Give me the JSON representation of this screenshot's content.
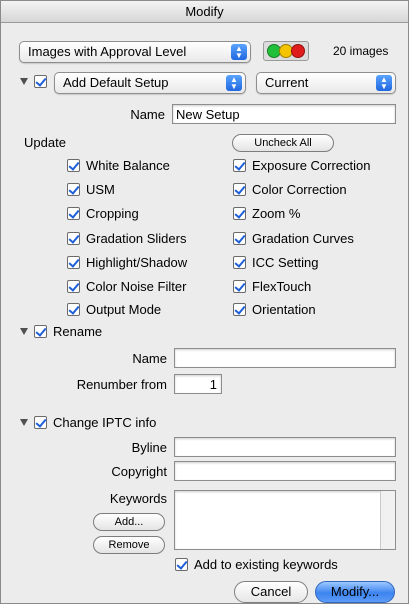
{
  "window": {
    "title": "Modify"
  },
  "filter": {
    "selected": "Images with Approval Level",
    "count": "20 images"
  },
  "colors": {
    "approval_green": "#22c03a",
    "approval_yellow": "#f4c400",
    "approval_red": "#e01b1b",
    "accent": "#2f7af0"
  },
  "setup": {
    "enabled": true,
    "preset": "Add Default Setup",
    "scope": "Current",
    "name_label": "Name",
    "name_value": "New Setup"
  },
  "update": {
    "label": "Update",
    "uncheck_all": "Uncheck All",
    "items_left": [
      "White Balance",
      "USM",
      "Cropping",
      "Gradation Sliders",
      "Highlight/Shadow",
      "Color Noise Filter",
      "Output Mode"
    ],
    "items_right": [
      "Exposure Correction",
      "Color Correction",
      "Zoom %",
      "Gradation Curves",
      "ICC Setting",
      "FlexTouch",
      "Orientation"
    ]
  },
  "rename": {
    "label": "Rename",
    "name_label": "Name",
    "name_value": "",
    "renumber_label": "Renumber from",
    "renumber_value": "1"
  },
  "iptc": {
    "label": "Change IPTC info",
    "byline_label": "Byline",
    "byline_value": "",
    "copyright_label": "Copyright",
    "copyright_value": "",
    "keywords_label": "Keywords",
    "keywords_value": "",
    "add_button": "Add...",
    "remove_button": "Remove",
    "add_existing_label": "Add to existing keywords"
  },
  "buttons": {
    "cancel": "Cancel",
    "modify": "Modify..."
  }
}
